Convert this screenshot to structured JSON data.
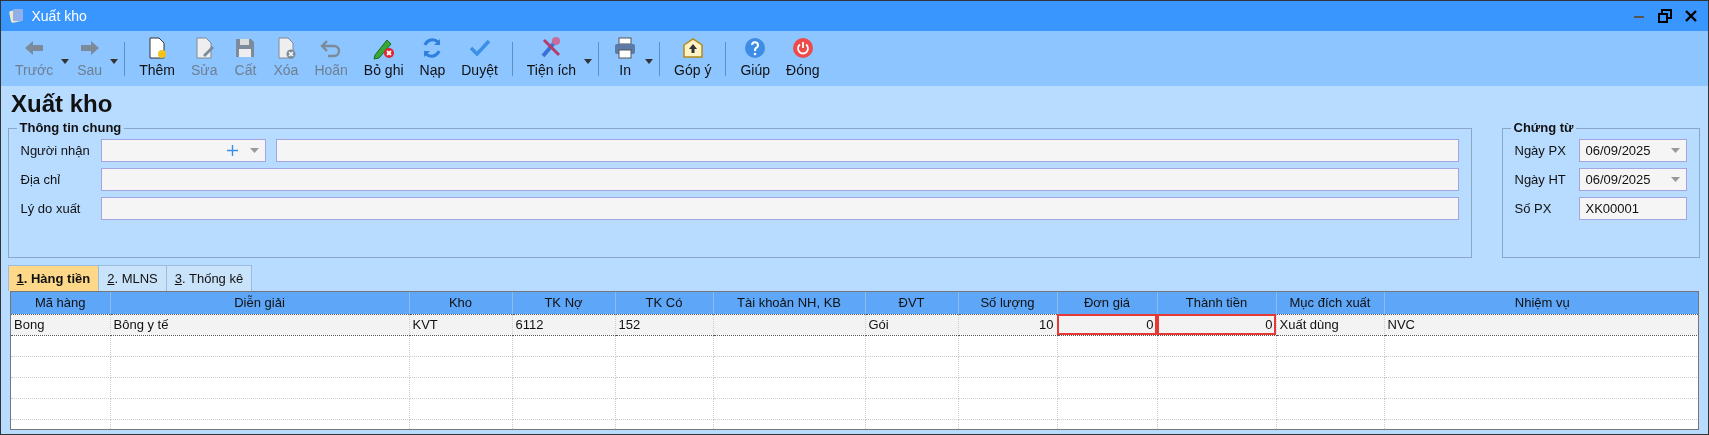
{
  "window": {
    "title": "Xuất kho"
  },
  "toolbar": [
    {
      "items": [
        {
          "label": "Trước",
          "disabled": true,
          "dropdown": true
        },
        {
          "label": "Sau",
          "disabled": true,
          "dropdown": true
        }
      ]
    },
    {
      "items": [
        {
          "label": "Thêm",
          "disabled": false,
          "dropdown": false
        },
        {
          "label": "Sửa",
          "disabled": true,
          "dropdown": false
        },
        {
          "label": "Cất",
          "disabled": true,
          "dropdown": false
        },
        {
          "label": "Xóa",
          "disabled": true,
          "dropdown": false
        },
        {
          "label": "Hoãn",
          "disabled": true,
          "dropdown": false
        },
        {
          "label": "Bỏ ghi",
          "disabled": false,
          "dropdown": false
        },
        {
          "label": "Nạp",
          "disabled": false,
          "dropdown": false
        },
        {
          "label": "Duyệt",
          "disabled": false,
          "dropdown": false
        }
      ]
    },
    {
      "items": [
        {
          "label": "Tiện ích",
          "disabled": false,
          "dropdown": true
        }
      ]
    },
    {
      "items": [
        {
          "label": "In",
          "disabled": false,
          "dropdown": true
        }
      ]
    },
    {
      "items": [
        {
          "label": "Góp ý",
          "disabled": false,
          "dropdown": false
        }
      ]
    },
    {
      "items": [
        {
          "label": "Giúp",
          "disabled": false,
          "dropdown": false
        },
        {
          "label": "Đóng",
          "disabled": false,
          "dropdown": false
        }
      ]
    }
  ],
  "heading": "Xuất kho",
  "general": {
    "title": "Thông tin chung",
    "fields": [
      {
        "label": "Người nhận",
        "kind": "lookup"
      },
      {
        "label": "Địa chỉ",
        "kind": "text"
      },
      {
        "label": "Lý do xuất",
        "kind": "text"
      }
    ]
  },
  "voucher": {
    "title": "Chứng từ",
    "fields": [
      {
        "label": "Ngày PX",
        "value": "06/09/2025",
        "kind": "date"
      },
      {
        "label": "Ngày HT",
        "value": "06/09/2025",
        "kind": "date"
      },
      {
        "label": "Số PX",
        "value": "XK00001",
        "kind": "text"
      }
    ]
  },
  "tabs": [
    {
      "label": "1. Hàng tiền",
      "selected": true
    },
    {
      "label": "2. MLNS",
      "selected": false
    },
    {
      "label": "3. Thống kê",
      "selected": false
    }
  ],
  "table": {
    "columns": [
      {
        "label": "Mã hàng",
        "kind": "text"
      },
      {
        "label": "Diễn giải",
        "kind": "text"
      },
      {
        "label": "Kho",
        "kind": "text"
      },
      {
        "label": "TK Nợ",
        "kind": "text"
      },
      {
        "label": "TK Có",
        "kind": "text"
      },
      {
        "label": "Tài khoản NH, KB",
        "kind": "text"
      },
      {
        "label": "ĐVT",
        "kind": "text"
      },
      {
        "label": "Số lượng",
        "kind": "number"
      },
      {
        "label": "Đơn giá",
        "kind": "number"
      },
      {
        "label": "Thành tiền",
        "kind": "number"
      },
      {
        "label": "Mục đích xuất",
        "kind": "text"
      },
      {
        "label": "Nhiệm vụ",
        "kind": "text"
      }
    ],
    "rows": [
      {
        "selected": true,
        "cells": [
          {
            "text": "Bong",
            "flagged": false
          },
          {
            "text": "Bông y tế",
            "flagged": false
          },
          {
            "text": "KVT",
            "flagged": false
          },
          {
            "text": "6112",
            "flagged": false
          },
          {
            "text": "152",
            "flagged": false
          },
          {
            "flagged": false
          },
          {
            "text": "Gói",
            "flagged": false
          },
          {
            "text": "10",
            "flagged": false
          },
          {
            "text": "0",
            "flagged": true
          },
          {
            "text": "0",
            "flagged": true
          },
          {
            "text": "Xuất dùng",
            "flagged": false
          },
          {
            "text": "NVC",
            "flagged": false
          }
        ]
      }
    ]
  }
}
